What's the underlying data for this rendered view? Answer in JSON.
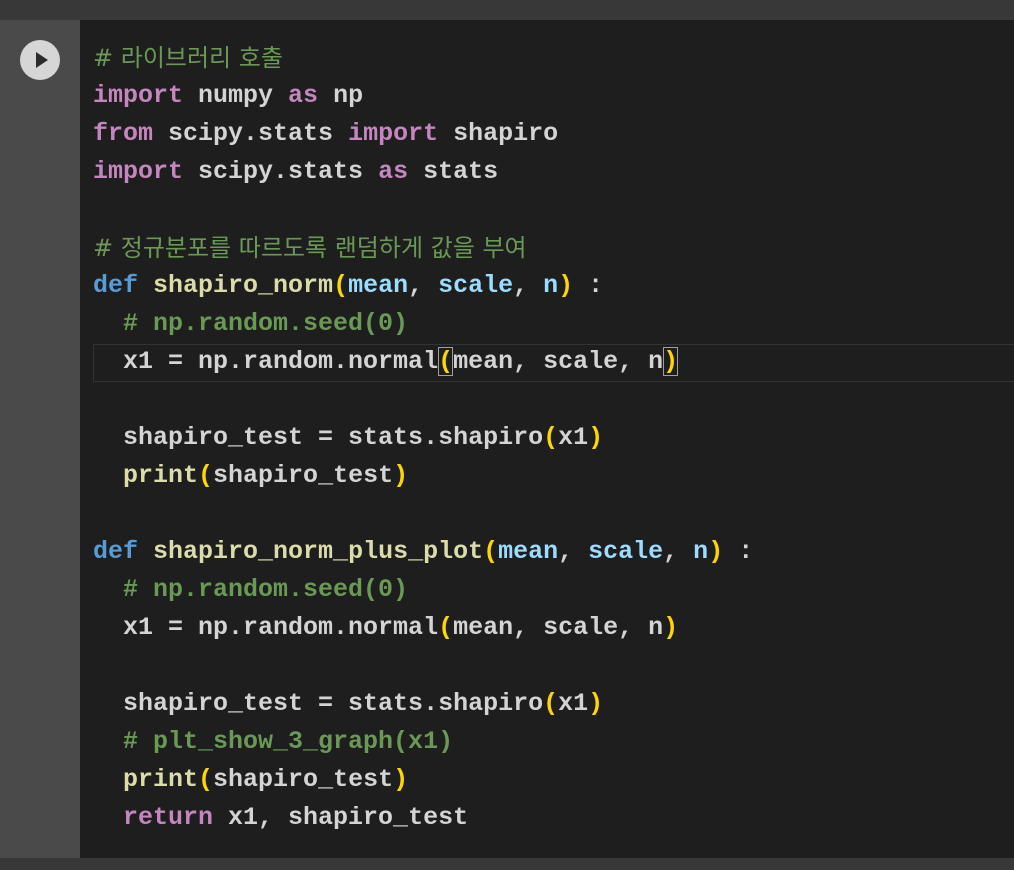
{
  "cell": {
    "run_button_icon": "play-icon",
    "lines": {
      "l1": {
        "comment": "# 라이브러리 호출"
      },
      "l2": {
        "kw1": "import",
        "mod": " numpy ",
        "kw2": "as",
        "alias": " np"
      },
      "l3": {
        "kw1": "from",
        "mod": " scipy.stats ",
        "kw2": "import",
        "name": " shapiro"
      },
      "l4": {
        "kw1": "import",
        "mod": " scipy.stats ",
        "kw2": "as",
        "alias": " stats"
      },
      "l6": {
        "comment": "# 정규분포를 따르도록 랜덤하게 값을 부여"
      },
      "l7": {
        "def": "def",
        "fn": "shapiro_norm",
        "p1": "mean",
        "p2": "scale",
        "p3": "n",
        "tail": " :"
      },
      "l8": {
        "comment": "# np.random.seed(0)"
      },
      "l9": {
        "pre": "x1 = np.random.normal",
        "args": "mean, scale, n"
      },
      "l11": {
        "pre": "shapiro_test = stats.shapiro",
        "args": "x1"
      },
      "l12": {
        "fn": "print",
        "args": "shapiro_test"
      },
      "l14": {
        "def": "def",
        "fn": "shapiro_norm_plus_plot",
        "p1": "mean",
        "p2": "scale",
        "p3": "n",
        "tail": " :"
      },
      "l15": {
        "comment": "# np.random.seed(0)"
      },
      "l16": {
        "pre": "x1 = np.random.normal",
        "args": "mean, scale, n"
      },
      "l18": {
        "pre": "shapiro_test = stats.shapiro",
        "args": "x1"
      },
      "l19": {
        "comment": "# plt_show_3_graph(x1)"
      },
      "l20": {
        "fn": "print",
        "args": "shapiro_test"
      },
      "l21": {
        "kw": "return",
        "rest": " x1, shapiro_test"
      }
    }
  },
  "colors": {
    "background": "#1e1e1e",
    "gutter": "#4a4a4a",
    "keyword": "#c586c0",
    "def_keyword": "#569cd6",
    "function": "#dcdcaa",
    "parameter": "#9cdcfe",
    "comment": "#6a9955",
    "bracket": "#ffd700"
  }
}
